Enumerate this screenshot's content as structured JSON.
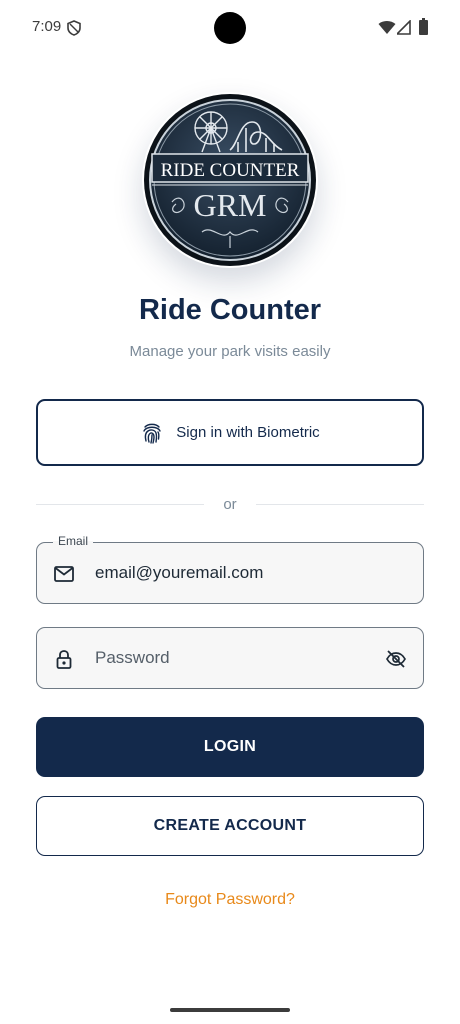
{
  "status_bar": {
    "time": "7:09"
  },
  "logo": {
    "line1": "RIDE COUNTER",
    "line2": "GRM"
  },
  "header": {
    "title": "Ride Counter",
    "subtitle": "Manage your park visits easily"
  },
  "biometric": {
    "label": "Sign in with Biometric"
  },
  "divider": {
    "text": "or"
  },
  "email": {
    "label": "Email",
    "value": "email@youremail.com"
  },
  "password": {
    "placeholder": "Password"
  },
  "actions": {
    "login": "LOGIN",
    "create": "CREATE ACCOUNT",
    "forgot": "Forgot Password?"
  },
  "colors": {
    "primary": "#13294b",
    "accent": "#e8891a",
    "muted": "#7b8a98"
  }
}
